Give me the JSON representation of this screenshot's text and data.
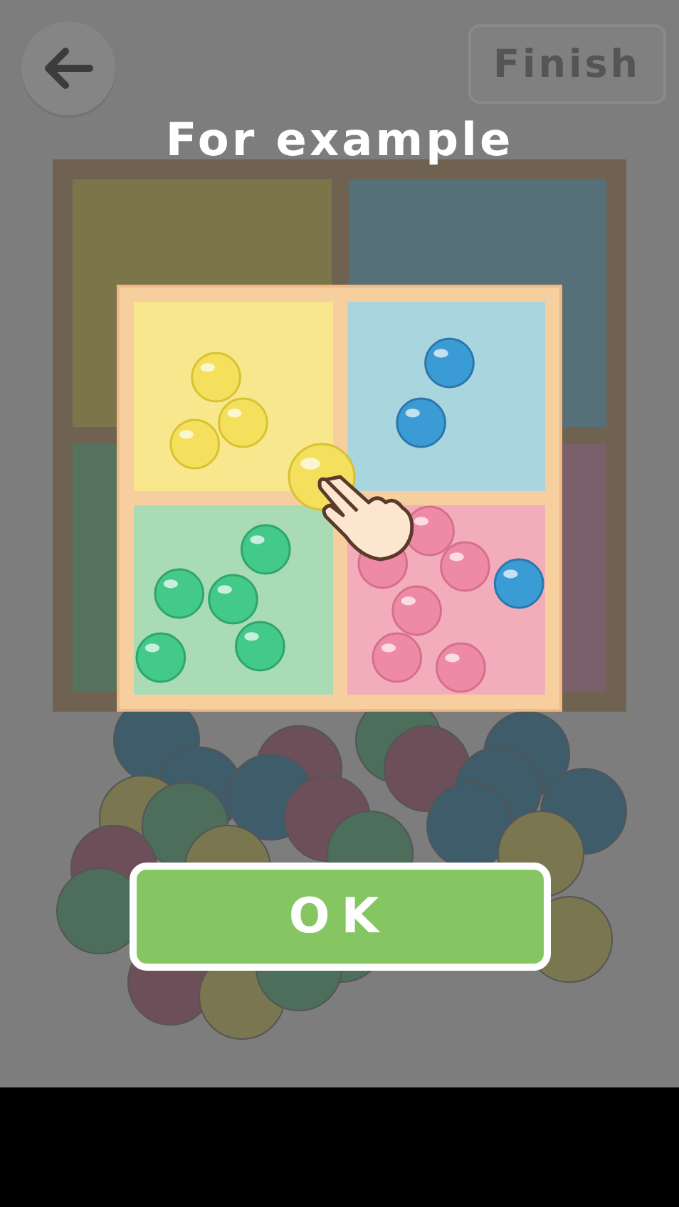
{
  "header": {
    "finish_button": "Finish"
  },
  "overlay": {
    "title": "For example",
    "confirm_button": "OK"
  }
}
